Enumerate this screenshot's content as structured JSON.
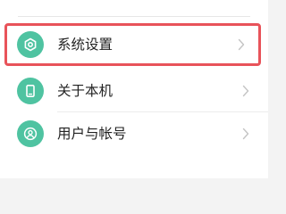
{
  "settings_list": {
    "items": [
      {
        "label": "系统设置",
        "icon": "settings-hexagon-icon",
        "selected": true
      },
      {
        "label": "关于本机",
        "icon": "phone-icon",
        "selected": false
      },
      {
        "label": "用户与帐号",
        "icon": "user-icon",
        "selected": false
      }
    ],
    "chevron": "chevron-right-icon"
  },
  "colors": {
    "icon_bg": "#4fc3a1",
    "highlight_border": "#e8535a",
    "text": "#222222",
    "chevron": "#c4c4c4"
  }
}
